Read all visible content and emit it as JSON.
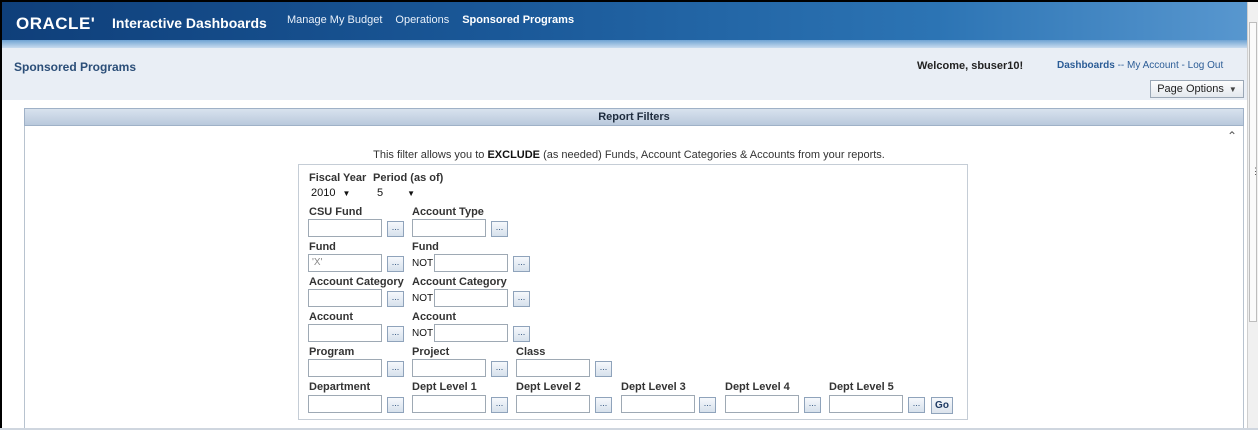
{
  "topbar": {
    "logo": "ORACLE'",
    "app_title": "Interactive Dashboards",
    "nav": [
      "Manage My Budget",
      "Operations",
      "Sponsored Programs"
    ]
  },
  "header": {
    "page_title": "Sponsored Programs",
    "welcome": "Welcome, sbuser10!",
    "dashboards_link": "Dashboards",
    "sep1": "--",
    "account_link": "My Account",
    "sep2": "-",
    "logout_link": "Log Out",
    "page_options": "Page Options"
  },
  "section": {
    "title": "Report Filters",
    "info_before": "This filter allows you to ",
    "info_strong": "EXCLUDE",
    "info_after": " (as needed) Funds, Account Categories & Accounts from your reports."
  },
  "filters": {
    "fiscal_year_label": "Fiscal Year",
    "fiscal_year_value": "2010",
    "period_label": "Period (as of)",
    "period_value": "5",
    "csu_fund_label": "CSU Fund",
    "account_type_label": "Account Type",
    "fund_label": "Fund",
    "fund_value": "'X'",
    "fund_not_label": "Fund",
    "account_category_label": "Account Category",
    "account_category_not_label": "Account Category",
    "account_label": "Account",
    "account_not_label": "Account",
    "not_text": "NOT",
    "program_label": "Program",
    "project_label": "Project",
    "class_label": "Class",
    "department_label": "Department",
    "dept_level_1_label": "Dept Level 1",
    "dept_level_2_label": "Dept Level 2",
    "dept_level_3_label": "Dept Level 3",
    "dept_level_4_label": "Dept Level 4",
    "dept_level_5_label": "Dept Level 5",
    "browse_label": "...",
    "go_label": "Go"
  }
}
